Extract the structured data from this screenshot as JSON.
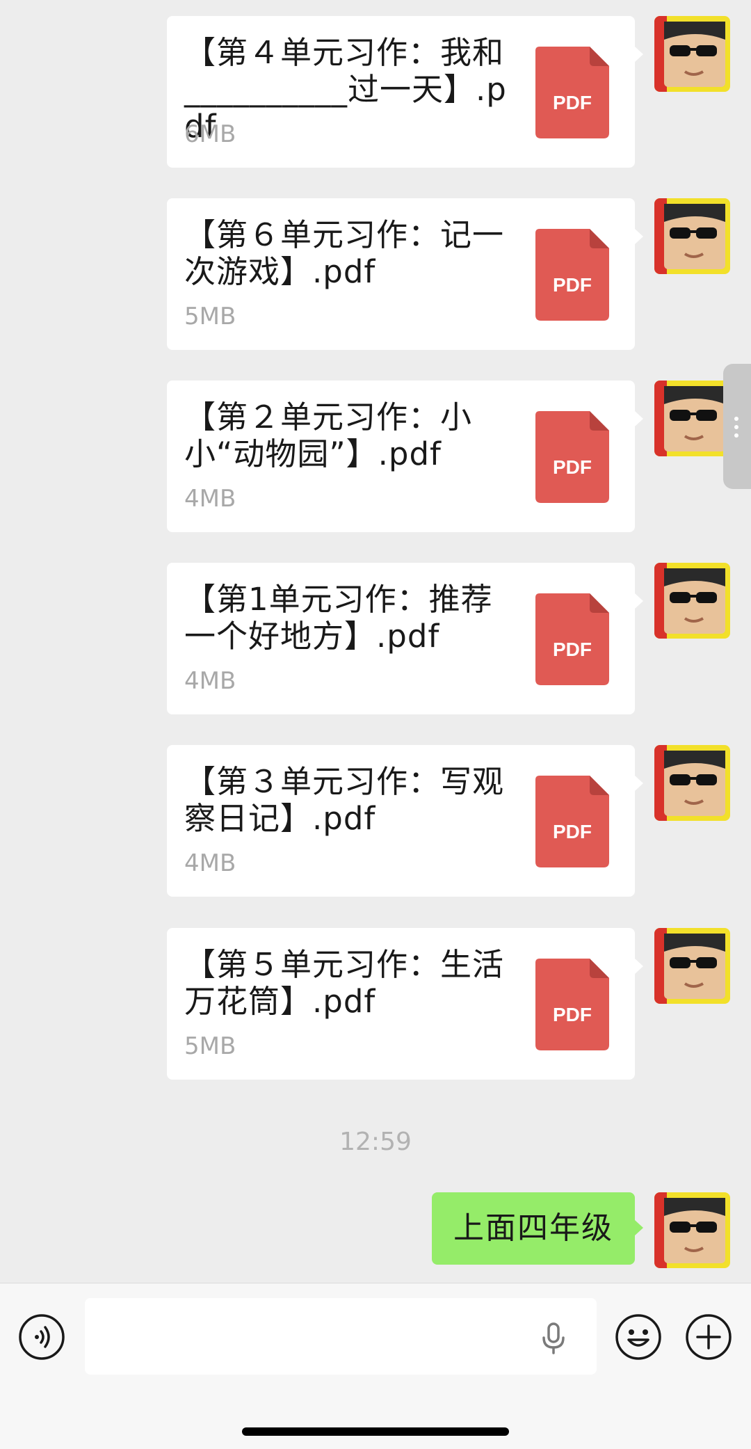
{
  "messages": [
    {
      "file_name": "【第４单元习作：我和__________过一天】.pdf",
      "size": "6MB"
    },
    {
      "file_name": "【第６单元习作：记一次游戏】.pdf",
      "size": "5MB"
    },
    {
      "file_name": "【第２单元习作：小小“动物园”】.pdf",
      "size": "4MB"
    },
    {
      "file_name": "【第1单元习作：推荐一个好地方】.pdf",
      "size": "4MB"
    },
    {
      "file_name": "【第３单元习作：写观察日记】.pdf",
      "size": "4MB"
    },
    {
      "file_name": "【第５单元习作：生活万花筒】.pdf",
      "size": "5MB"
    }
  ],
  "pdf_label": "PDF",
  "timestamp": "12:59",
  "text_message": "上面四年级",
  "colors": {
    "pdf_red": "#e05a54",
    "bubble_green": "#95ec69",
    "background": "#ededed"
  },
  "icons": {
    "voice": "voice-input-icon",
    "mic": "microphone-icon",
    "emoji": "emoji-icon",
    "plus": "plus-icon"
  }
}
